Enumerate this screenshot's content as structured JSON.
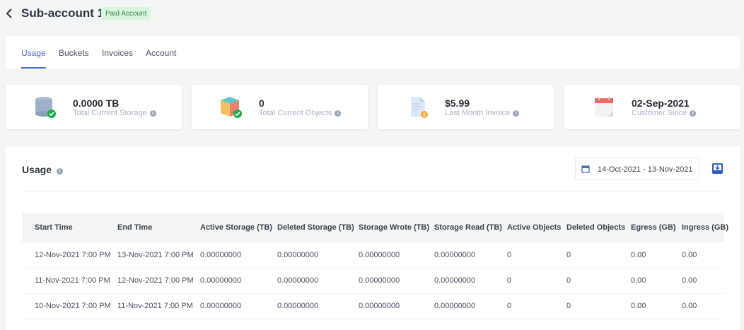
{
  "header": {
    "title": "Sub-account 123",
    "badge": "Paid Account"
  },
  "tabs": [
    {
      "label": "Usage",
      "active": true
    },
    {
      "label": "Buckets"
    },
    {
      "label": "Invoices"
    },
    {
      "label": "Account"
    }
  ],
  "cards": [
    {
      "icon": "database-icon",
      "value": "0.0000 TB",
      "label": "Total Current Storage"
    },
    {
      "icon": "cube-icon",
      "value": "0",
      "label": "Total Current Objects"
    },
    {
      "icon": "invoice-icon",
      "value": "$5.99",
      "label": "Last Month Invoice"
    },
    {
      "icon": "calendar-icon",
      "value": "02-Sep-2021",
      "label": "Customer Since"
    }
  ],
  "usage": {
    "title": "Usage",
    "date_range": "14-Oct-2021 - 13-Nov-2021",
    "columns": [
      "Start Time",
      "End Time",
      "Active Storage (TB)",
      "Deleted Storage (TB)",
      "Storage Wrote (TB)",
      "Storage Read (TB)",
      "Active Objects",
      "Deleted Objects",
      "Egress (GB)",
      "Ingress (GB)"
    ],
    "rows": [
      [
        "12-Nov-2021 7:00 PM",
        "13-Nov-2021 7:00 PM",
        "0.00000000",
        "0.00000000",
        "0.00000000",
        "0.00000000",
        "0",
        "0",
        "0.00",
        "0.00"
      ],
      [
        "11-Nov-2021 7:00 PM",
        "12-Nov-2021 7:00 PM",
        "0.00000000",
        "0.00000000",
        "0.00000000",
        "0.00000000",
        "0",
        "0",
        "0.00",
        "0.00"
      ],
      [
        "10-Nov-2021 7:00 PM",
        "11-Nov-2021 7:00 PM",
        "0.00000000",
        "0.00000000",
        "0.00000000",
        "0.00000000",
        "0",
        "0",
        "0.00",
        "0.00"
      ]
    ]
  }
}
